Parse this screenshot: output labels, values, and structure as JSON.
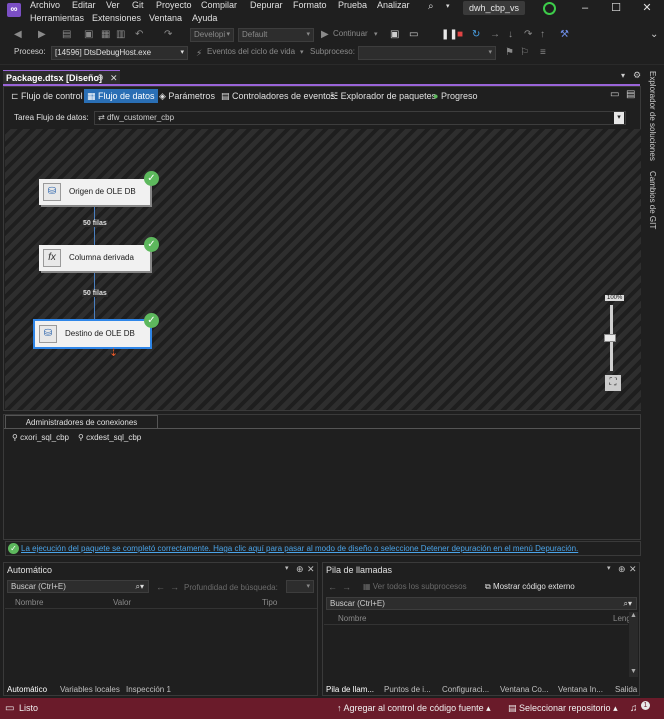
{
  "menu": [
    "Archivo",
    "Editar",
    "Ver",
    "Git",
    "Proyecto",
    "Compilar",
    "Depurar",
    "Formato",
    "Prueba",
    "Analizar",
    "Herramientas",
    "Extensiones",
    "Ventana",
    "Ayuda"
  ],
  "solution_name": "dwh_cbp_vs",
  "toolbar": {
    "config": "Developi",
    "platform": "Default",
    "continue": "Continuar"
  },
  "toolbar2": {
    "process_label": "Proceso:",
    "process_value": "[14596] DtsDebugHost.exe",
    "lifecycle": "Eventos del ciclo de vida",
    "subprocess": "Subproceso:"
  },
  "doc_tab": {
    "title": "Package.dtsx [Diseño]",
    "pin": "⊕",
    "close": "✕"
  },
  "designer_tabs": [
    "Flujo de control",
    "Flujo de datos",
    "Parámetros",
    "Controladores de eventos",
    "Explorador de paquetes",
    "Progreso"
  ],
  "task": {
    "label": "Tarea Flujo de datos:",
    "value": "dfw_customer_cbp"
  },
  "nodes": [
    "Origen de OLE DB",
    "Columna derivada",
    "Destino de OLE DB"
  ],
  "flows": [
    "50 filas",
    "50 filas"
  ],
  "zoom": "100%",
  "connection_manager": {
    "tab": "Administradores de conexiones",
    "items": [
      "cxori_sql_cbp",
      "cxdest_sql_cbp"
    ]
  },
  "status_message": "La ejecución del paquete se completó correctamente. Haga clic aquí para pasar al modo de diseño o seleccione Detener depuración en el menú Depuración.",
  "autos": {
    "title": "Automático",
    "search": "Buscar (Ctrl+E)",
    "depth": "Profundidad de búsqueda:",
    "cols": [
      "Nombre",
      "Valor",
      "Tipo"
    ],
    "tabs": [
      "Automático",
      "Variables locales",
      "Inspección 1"
    ]
  },
  "callstack": {
    "title": "Pila de llamadas",
    "show_all": "Ver todos los subprocesos",
    "external": "Mostrar código externo",
    "search": "Buscar (Ctrl+E)",
    "cols": [
      "Nombre",
      "Leng"
    ],
    "tabs": [
      "Pila de llam...",
      "Puntos de i...",
      "Configuraci...",
      "Ventana Co...",
      "Ventana In...",
      "Salida"
    ]
  },
  "status": {
    "ready": "Listo",
    "source_control": "Agregar al control de código fuente",
    "repo": "Seleccionar repositorio",
    "notif": "1"
  },
  "side": [
    "Explorador de soluciones",
    "Cambios de GIT"
  ],
  "colors": {
    "accent": "#9a64d8",
    "statusbar": "#6a1b2a",
    "check": "#5db85d",
    "link": "#4aa3e8",
    "active_tab": "#2a6fb5"
  }
}
